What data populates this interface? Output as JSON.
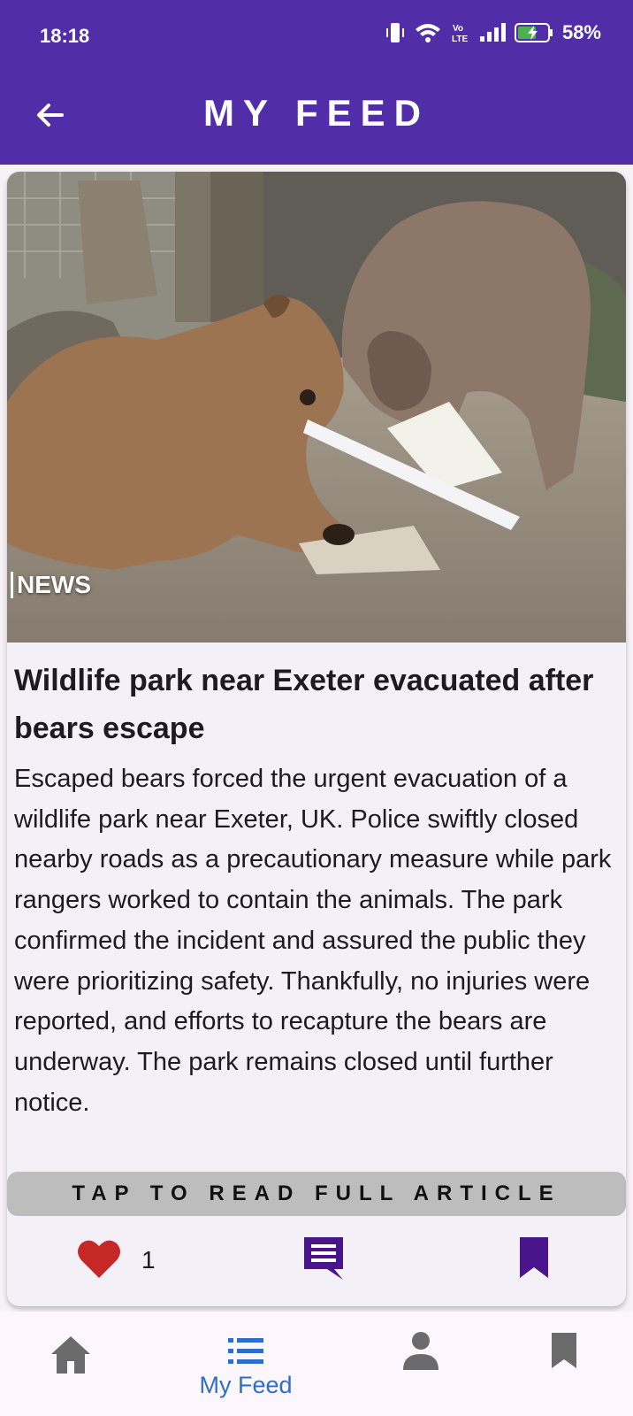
{
  "status_bar": {
    "time": "18:18",
    "battery": "58%",
    "network": "LTE"
  },
  "app_bar": {
    "title": "MY FEED",
    "back_icon": "arrow-left-icon"
  },
  "article": {
    "image_alt": "Two bears in an enclosure, one chewing a paper tube",
    "tag": "NEWS",
    "headline": "Wildlife park near Exeter evacuated after bears escape",
    "summary": "Escaped bears forced the urgent evacuation of a wildlife park near Exeter, UK. Police swiftly closed nearby roads as a precautionary measure while park rangers worked to contain the animals. The park confirmed the incident and assured the public they were prioritizing safety. Thankfully, no injuries were reported, and efforts to recapture the bears are underway. The park remains closed until further notice.",
    "read_more": "TAP TO READ FULL ARTICLE",
    "like_count": "1"
  },
  "bottom_nav": {
    "items": [
      {
        "icon": "home-icon",
        "label": ""
      },
      {
        "icon": "list-icon",
        "label": "My Feed",
        "active": true
      },
      {
        "icon": "person-icon",
        "label": ""
      },
      {
        "icon": "bookmark-icon",
        "label": ""
      }
    ]
  },
  "colors": {
    "primary": "#512da8",
    "like": "#c62828",
    "action": "#4a148c",
    "nav_active": "#2d6fc8",
    "nav_inactive": "#6b6b6b"
  }
}
